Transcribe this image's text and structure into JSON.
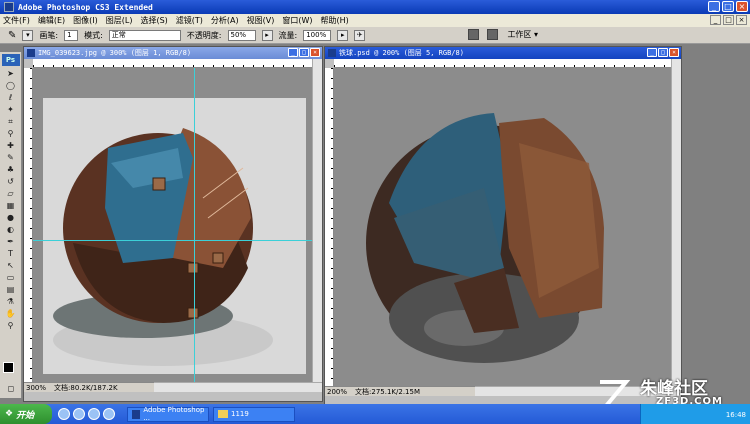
{
  "app": {
    "title": "Adobe Photoshop CS3 Extended",
    "ps_mark": "Ps"
  },
  "menu": [
    "文件(F)",
    "编辑(E)",
    "图像(I)",
    "图层(L)",
    "选择(S)",
    "滤镜(T)",
    "分析(A)",
    "视图(V)",
    "窗口(W)",
    "帮助(H)"
  ],
  "options": {
    "brush_label": "画笔:",
    "brush_size": "1",
    "mode_label": "模式:",
    "mode_value": "正常",
    "opacity_label": "不透明度:",
    "opacity_value": "50%",
    "flow_label": "流量:",
    "flow_value": "100%",
    "workspace_label": "工作区"
  },
  "doc1": {
    "title": "IMG_039623.jpg @ 300% (图层 1, RGB/8)",
    "zoom": "300%",
    "doc_size": "文档:80.2K/187.2K"
  },
  "doc2": {
    "title": "铁球.psd @ 200% (图层 5, RGB/8)",
    "zoom": "200%",
    "doc_size": "文档:275.1K/2.15M"
  },
  "taskbar": {
    "start": "开始",
    "item1": "Adobe Photoshop ...",
    "item2": "1119",
    "clock": "16:48"
  },
  "watermark": {
    "cn": "朱峰社区",
    "en": "ZF3D.COM"
  },
  "colors": {
    "guide": "#3cd0d8",
    "canvas": "#8c8c8c"
  }
}
